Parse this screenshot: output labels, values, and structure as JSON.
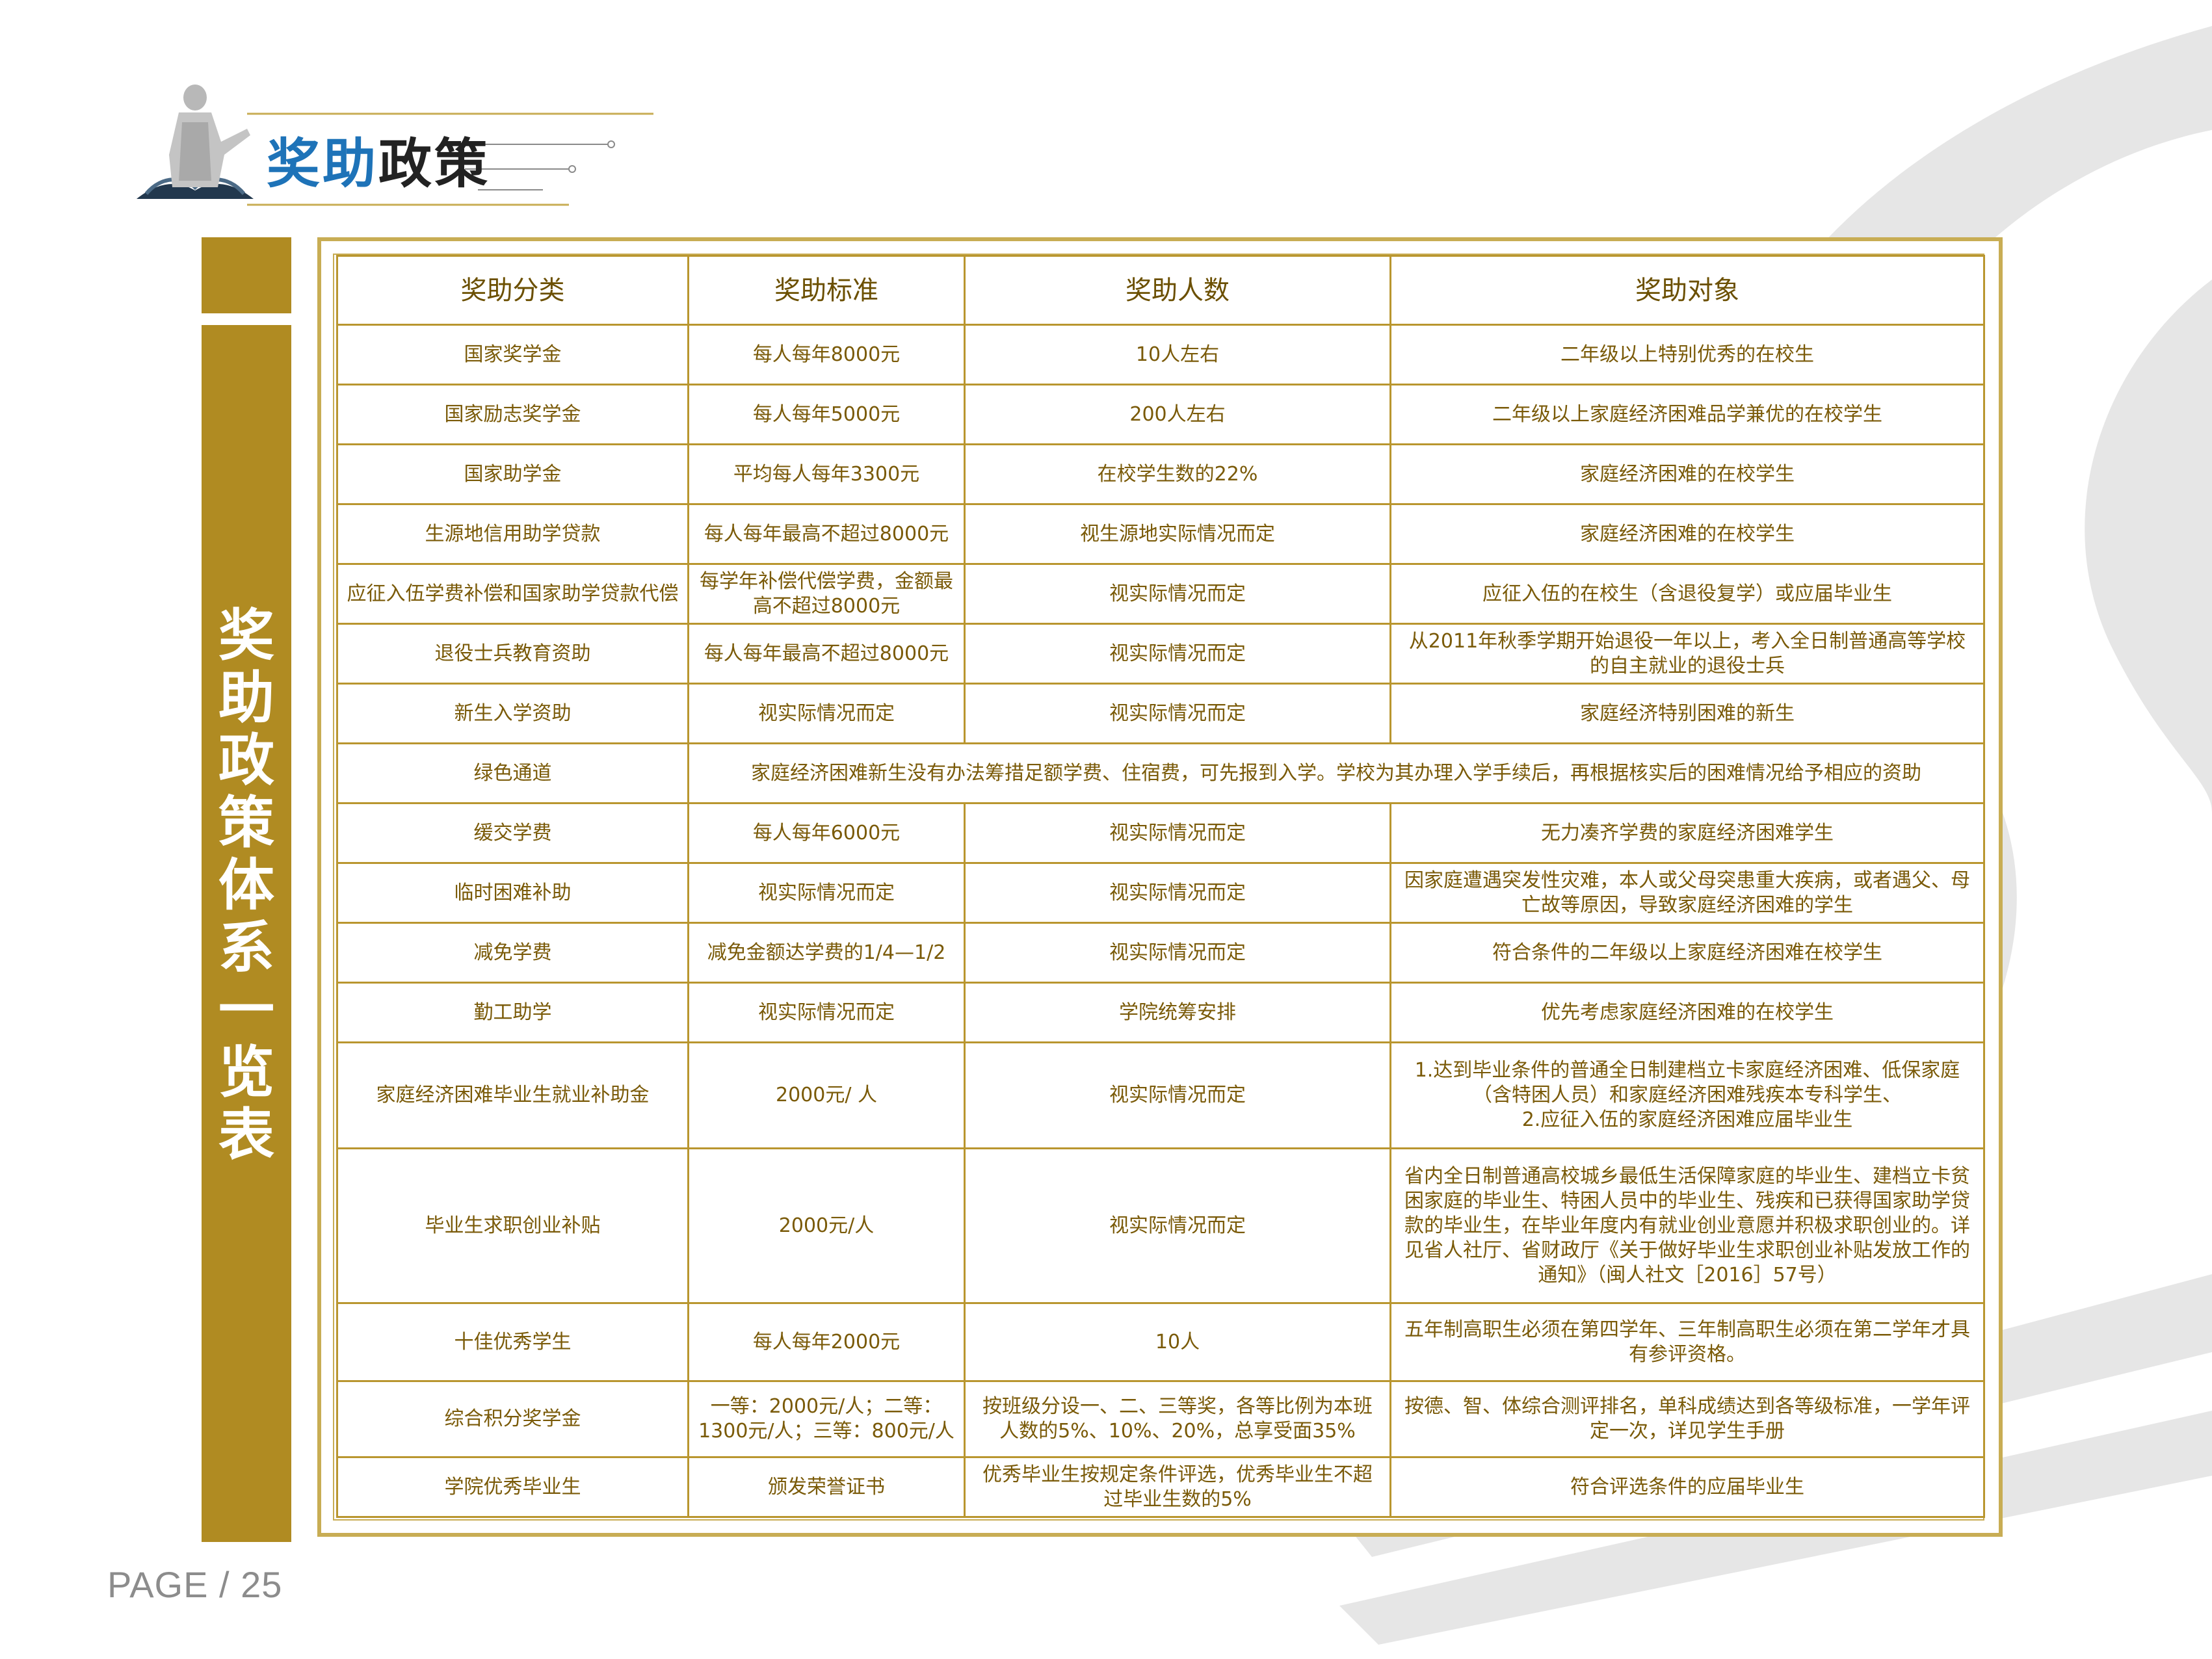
{
  "header": {
    "title_part1": "奖助",
    "title_part2": "政策"
  },
  "sidebar": {
    "title": "奖助政策体系一览表"
  },
  "table": {
    "headers": [
      "奖助分类",
      "奖助标准",
      "奖助人数",
      "奖助对象"
    ],
    "rows": [
      {
        "category": "国家奖学金",
        "standard": "每人每年8000元",
        "count": "10人左右",
        "target": "二年级以上特别优秀的在校生"
      },
      {
        "category": "国家励志奖学金",
        "standard": "每人每年5000元",
        "count": "200人左右",
        "target": "二年级以上家庭经济困难品学兼优的在校学生"
      },
      {
        "category": "国家助学金",
        "standard": "平均每人每年3300元",
        "count": "在校学生数的22%",
        "target": "家庭经济困难的在校学生"
      },
      {
        "category": "生源地信用助学贷款",
        "standard": "每人每年最高不超过8000元",
        "count": "视生源地实际情况而定",
        "target": "家庭经济困难的在校学生"
      },
      {
        "category": "应征入伍学费补偿和国家助学贷款代偿",
        "standard": "每学年补偿代偿学费，金额最高不超过8000元",
        "count": "视实际情况而定",
        "target": "应征入伍的在校生（含退役复学）或应届毕业生"
      },
      {
        "category": "退役士兵教育资助",
        "standard": "每人每年最高不超过8000元",
        "count": "视实际情况而定",
        "target": "从2011年秋季学期开始退役一年以上，考入全日制普通高等学校的自主就业的退役士兵"
      },
      {
        "category": "新生入学资助",
        "standard": "视实际情况而定",
        "count": "视实际情况而定",
        "target": "家庭经济特别困难的新生"
      },
      {
        "category": "绿色通道",
        "merged": "家庭经济困难新生没有办法筹措足额学费、住宿费，可先报到入学。学校为其办理入学手续后，再根据核实后的困难情况给予相应的资助"
      },
      {
        "category": "缓交学费",
        "standard": "每人每年6000元",
        "count": "视实际情况而定",
        "target": "无力凑齐学费的家庭经济困难学生"
      },
      {
        "category": "临时困难补助",
        "standard": "视实际情况而定",
        "count": "视实际情况而定",
        "target": "因家庭遭遇突发性灾难，本人或父母突患重大疾病，或者遇父、母亡故等原因，导致家庭经济困难的学生"
      },
      {
        "category": "减免学费",
        "standard": "减免金额达学费的1/4—1/2",
        "count": "视实际情况而定",
        "target": "符合条件的二年级以上家庭经济困难在校学生"
      },
      {
        "category": "勤工助学",
        "standard": "视实际情况而定",
        "count": "学院统筹安排",
        "target": "优先考虑家庭经济困难的在校学生"
      },
      {
        "category": "家庭经济困难毕业生就业补助金",
        "standard": "2000元/ 人",
        "count": "视实际情况而定",
        "target": "1.达到毕业条件的普通全日制建档立卡家庭经济困难、低保家庭（含特困人员）和家庭经济困难残疾本专科学生、\n2.应征入伍的家庭经济困难应届毕业生"
      },
      {
        "category": "毕业生求职创业补贴",
        "standard": "2000元/人",
        "count": "视实际情况而定",
        "target": "省内全日制普通高校城乡最低生活保障家庭的毕业生、建档立卡贫困家庭的毕业生、特困人员中的毕业生、残疾和已获得国家助学贷款的毕业生，在毕业年度内有就业创业意愿并积极求职创业的。详见省人社厅、省财政厅《关于做好毕业生求职创业补贴发放工作的通知》（闽人社文［2016］57号）"
      },
      {
        "category": "十佳优秀学生",
        "standard": "每人每年2000元",
        "count": "10人",
        "target": "五年制高职生必须在第四学年、三年制高职生必须在第二学年才具有参评资格。"
      },
      {
        "category": "综合积分奖学金",
        "standard": "一等：2000元/人；二等：1300元/人；三等：800元/人",
        "count": "按班级分设一、二、三等奖，各等比例为本班人数的5%、10%、20%，总享受面35%",
        "target": "按德、智、体综合测评排名，单科成绩达到各等级标准，一学年评定一次，详见学生手册"
      },
      {
        "category": "学院优秀毕业生",
        "standard": "颁发荣誉证书",
        "count": "优秀毕业生按规定条件评选，优秀毕业生不超过毕业生数的5%",
        "target": "符合评选条件的应届毕业生"
      }
    ]
  },
  "footer": {
    "page_label": "PAGE / 25"
  },
  "colors": {
    "gold": "#b08b22",
    "border": "#b9962f",
    "text": "#7a5a08",
    "title_blue": "#1e73b8",
    "deco_gray": "#e6e6e6"
  }
}
